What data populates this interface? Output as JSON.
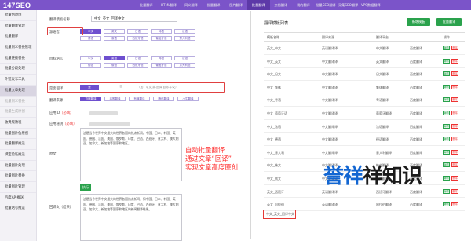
{
  "app": {
    "logo": "147SEO"
  },
  "topnav": [
    {
      "label": "批量翻译",
      "active": false
    },
    {
      "label": "HTML翻译",
      "active": false
    },
    {
      "label": "同义翻译",
      "active": false
    },
    {
      "label": "批量翻译",
      "active": false
    },
    {
      "label": "图片翻译",
      "active": false
    },
    {
      "label": "批量翻译",
      "active": true
    },
    {
      "label": "文档翻译",
      "active": false
    },
    {
      "label": "我的翻译",
      "active": false
    },
    {
      "label": "批量SEO翻译",
      "active": false
    },
    {
      "label": "采集SEO翻译",
      "active": false
    },
    {
      "label": "VPS数据翻译",
      "active": false
    }
  ],
  "sidebar": [
    {
      "label": "批量伪原创",
      "state": "normal"
    },
    {
      "label": "批量翻译管理",
      "state": "normal"
    },
    {
      "label": "批量翻译",
      "state": "normal"
    },
    {
      "label": "批量同义替换管理",
      "state": "normal"
    },
    {
      "label": "批量链接替换",
      "state": "normal"
    },
    {
      "label": "批量分段处理",
      "state": "normal"
    },
    {
      "label": "外链发布工具",
      "state": "normal"
    },
    {
      "label": "批量文章处理",
      "state": "active"
    },
    {
      "label": "批量同义替换",
      "state": "dim"
    },
    {
      "label": "批量生成原创",
      "state": "dim"
    },
    {
      "label": "收费版教程",
      "state": "normal"
    },
    {
      "label": "批量图片伪原创",
      "state": "normal"
    },
    {
      "label": "批量翻译推送",
      "state": "normal"
    },
    {
      "label": "绑定验证推送",
      "state": "normal"
    },
    {
      "label": "批量图片处理",
      "state": "normal"
    },
    {
      "label": "批量图片替换",
      "state": "normal"
    },
    {
      "label": "批量图片管理",
      "state": "normal"
    },
    {
      "label": "百度API推送",
      "state": "normal"
    },
    {
      "label": "批量站号推送",
      "state": "normal"
    }
  ],
  "form": {
    "template_label": "翻译模板名称",
    "template_value": "中文_英文_回译中文",
    "source_label": "源语言",
    "source_chips": [
      "中文",
      "英文",
      "日语",
      "韩语",
      "法语",
      "德语",
      "俄语",
      "西班牙语",
      "葡萄牙语",
      "意大利语"
    ],
    "target_label": "目标语言",
    "target_chips": [
      "中文",
      "英语",
      "日语",
      "韩语",
      "法语",
      "德语",
      "俄语",
      "西班牙语",
      "葡萄牙语",
      "意大利语"
    ],
    "backtranslate_label": "是否回译",
    "backtranslate_yes": "是",
    "backtranslate_no": "否",
    "backtranslate_hint": "（如：中文-英-回译 目标-中文）",
    "engine_label": "翻译来源",
    "engine_chips": [
      "百度翻译",
      "谷歌翻译",
      "有道翻译",
      "腾讯翻译",
      "小牛翻译"
    ],
    "appid_label": "应用ID",
    "appid_req": "（必填）",
    "appkey_label": "应用秘钥",
    "appkey_req": "（必填）",
    "original_label": "原文",
    "original_text": "这是当今世界中文最大的世界各国的热点新闻，中国、日本、韩国、英国、德国、法国、美国、俄罗斯、印度、巴西、西班牙、意大利、澳大利亚、加拿大、新加坡等国家和地区。",
    "translate_button": "执行",
    "result_label": "回译文（结果）",
    "result_text": "这是当今世界中文最大的世界各国热点新闻，如中国、日本、韩国、英国、德国、法国、美国、俄罗斯、印度、巴西、西班牙、意大利、澳大利亚、加拿大、新加坡等国家和地区的新闻翻译结果。"
  },
  "annotation": [
    "自动批量翻译",
    "通过文章“回译”",
    "实现文章高度原创"
  ],
  "right": {
    "title": "翻译模板列表",
    "add_button": "新增模板",
    "batch_button": "批量翻译",
    "columns": [
      "模板名称",
      "翻译来源",
      "翻译平台",
      "操作"
    ],
    "edit_label": "编辑",
    "delete_label": "删除",
    "rows": [
      {
        "name": "英文_中文",
        "source": "英语翻译译",
        "target": "中文翻译",
        "platform": "百度翻译"
      },
      {
        "name": "中文_英文",
        "source": "中文翻译译",
        "target": "英文翻译",
        "platform": "百度翻译"
      },
      {
        "name": "中文_日文",
        "source": "中文翻译译",
        "target": "日文翻译",
        "platform": "百度翻译"
      },
      {
        "name": "中文_繁体",
        "source": "中文翻译译",
        "target": "繁体翻译",
        "platform": "百度翻译"
      },
      {
        "name": "中文_粤语",
        "source": "中文翻译译",
        "target": "粤语翻译",
        "platform": "百度翻译"
      },
      {
        "name": "中文_葡萄牙语",
        "source": "中文翻译译",
        "target": "葡萄牙翻译",
        "platform": "百度翻译"
      },
      {
        "name": "中文_法语",
        "source": "中文翻译译",
        "target": "法语翻译",
        "platform": "百度翻译"
      },
      {
        "name": "中文_德语",
        "source": "中文翻译译",
        "target": "德语翻译",
        "platform": "百度翻译"
      },
      {
        "name": "中文_意大利",
        "source": "中文翻译译",
        "target": "意大利翻译",
        "platform": "百度翻译"
      },
      {
        "name": "中文_韩文",
        "source": "中文翻译译",
        "target": "韩文翻译",
        "platform": "百度翻译"
      },
      {
        "name": "中文_俄文",
        "source": "中文翻译译",
        "target": "俄文翻译",
        "platform": "百度翻译"
      },
      {
        "name": "英文_西班牙",
        "source": "英语翻译译",
        "target": "西班牙翻译",
        "platform": "百度翻译"
      },
      {
        "name": "英文_阿拉伯",
        "source": "英语翻译译",
        "target": "阿拉伯翻译",
        "platform": "百度翻译"
      }
    ],
    "highlight_row": "中文_英文_回译中文"
  },
  "watermark": {
    "part1": "誉",
    "part2": "祥",
    "part3": "祥知识"
  }
}
